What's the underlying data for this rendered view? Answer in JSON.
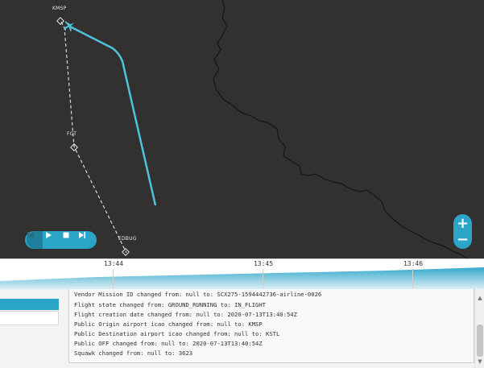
{
  "map": {
    "waypoints": [
      {
        "label": "KMSP"
      },
      {
        "label": "FGT"
      },
      {
        "label": "EDBUG"
      }
    ],
    "colors": {
      "background": "#333130",
      "track": "#4ec3dc",
      "planned_route": "#d9d9d9",
      "border_line": "#141414"
    },
    "aircraft_icon": "airplane-icon"
  },
  "player": {
    "buttons": [
      "rewind-icon",
      "play-icon",
      "stop-icon",
      "skip-to-end-icon"
    ]
  },
  "zoom": {
    "in_label": "+",
    "out_label": "−"
  },
  "timeline": {
    "ticks": [
      "13:44",
      "13:45",
      "13:46"
    ]
  },
  "log": {
    "lines": [
      "Vendor Mission ID changed from: null to: SCX275-1594442736-airline-0026",
      "Flight state changed from: GROUND_RUNNING to: IN_FLIGHT",
      "Flight creation date changed from: null to: 2020-07-13T13:40:54Z",
      "Public Origin airport icao changed from: null to: KMSP",
      "Public Destination airport icao changed from: null to: KSTL",
      "Public OFF changed from: null to: 2020-07-13T13:40:54Z",
      "Squawk changed from: null to: 3623"
    ]
  },
  "scrollbar": {
    "up_icon": "chevron-up-icon",
    "down_icon": "chevron-down-icon"
  }
}
